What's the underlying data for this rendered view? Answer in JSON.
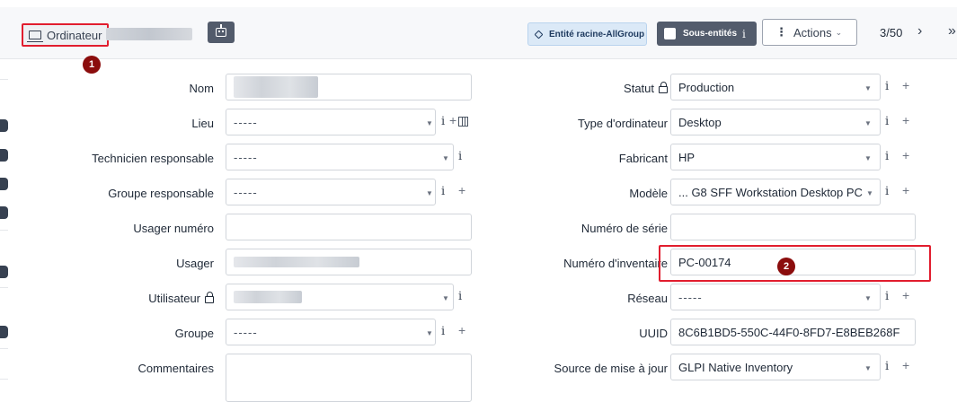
{
  "header": {
    "breadcrumb_label": "Ordinateur",
    "entity_button": "Entité racine-AllGroup",
    "subentities_label": "Sous-entités",
    "subentities_info": "i",
    "actions_label": "Actions",
    "pager": "3/50",
    "next_glyph": "›",
    "last_glyph": "»",
    "badge_1": "1",
    "badge_2": "2"
  },
  "form": {
    "left": {
      "nom": {
        "label": "Nom"
      },
      "lieu": {
        "label": "Lieu",
        "value": "-----"
      },
      "technicien": {
        "label": "Technicien responsable",
        "value": "-----"
      },
      "groupe_resp": {
        "label": "Groupe responsable",
        "value": "-----"
      },
      "usager_numero": {
        "label": "Usager numéro",
        "value": ""
      },
      "usager": {
        "label": "Usager"
      },
      "utilisateur": {
        "label": "Utilisateur"
      },
      "groupe": {
        "label": "Groupe",
        "value": "-----"
      },
      "commentaires": {
        "label": "Commentaires"
      }
    },
    "right": {
      "statut": {
        "label": "Statut",
        "value": "Production"
      },
      "type": {
        "label": "Type d'ordinateur",
        "value": "Desktop"
      },
      "fabricant": {
        "label": "Fabricant",
        "value": "HP"
      },
      "modele": {
        "label": "Modèle",
        "value": "... G8 SFF Workstation Desktop PC"
      },
      "serie": {
        "label": "Numéro de série",
        "value": ""
      },
      "inventaire": {
        "label": "Numéro d'inventaire",
        "value": "PC-00174"
      },
      "reseau": {
        "label": "Réseau",
        "value": "-----"
      },
      "uuid": {
        "label": "UUID",
        "value": "8C6B1BD5-550C-44F0-8FD7-E8BEB268F"
      },
      "source": {
        "label": "Source de mise à jour",
        "value": "GLPI Native Inventory"
      }
    },
    "glyphs": {
      "info": "i",
      "plus": "+",
      "caret": "▼"
    }
  },
  "colors": {
    "accent_red": "#e11d2e",
    "badge": "#8b0d0d",
    "dark_button": "#535c6c"
  }
}
